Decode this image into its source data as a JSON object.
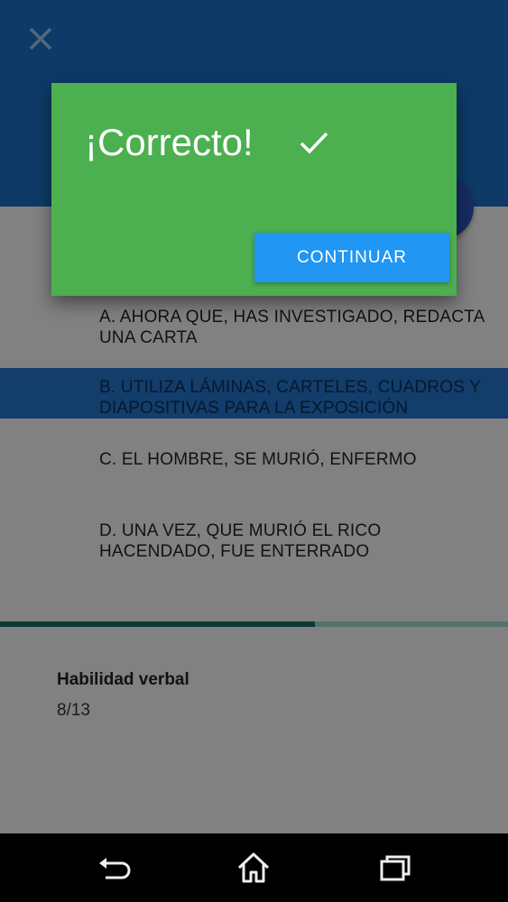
{
  "header": {
    "close_icon": "close-icon",
    "color": "#1a6fc0"
  },
  "options": [
    {
      "label": "A. AHORA QUE, HAS INVESTIGADO, REDACTA UNA CARTA",
      "selected": false
    },
    {
      "label": "B. UTILIZA LÁMINAS, CARTELES, CUADROS Y DIAPOSITIVAS PARA LA EXPOSICIÓN",
      "selected": true
    },
    {
      "label": "C. EL HOMBRE, SE MURIÓ, ENFERMO",
      "selected": false
    },
    {
      "label": "D. UNA VEZ, QUE MURIÓ EL RICO HACENDADO, FUE ENTERRADO",
      "selected": false
    }
  ],
  "progress": {
    "fraction": 0.62,
    "fill_color": "#166e62",
    "track_color": "#9fd7ce"
  },
  "section": {
    "title": "Habilidad verbal",
    "progress_text": "8/13"
  },
  "dialog": {
    "title": "¡Correcto!",
    "title_icon": "check-icon",
    "button_label": "CONTINUAR",
    "background_color": "#4caf50",
    "button_color": "#2196f3"
  },
  "navbar": {
    "icons": [
      "back-icon",
      "home-icon",
      "recent-apps-icon"
    ]
  }
}
